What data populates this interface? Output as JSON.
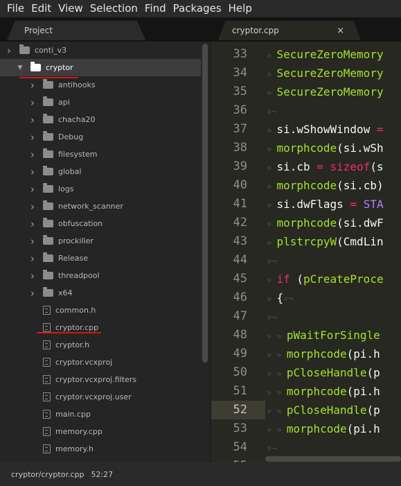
{
  "menubar": [
    "File",
    "Edit",
    "View",
    "Selection",
    "Find",
    "Packages",
    "Help"
  ],
  "tabs": {
    "project": "Project",
    "file": "cryptor.cpp",
    "close_glyph": "×"
  },
  "tree": [
    {
      "label": "conti_v3",
      "type": "folder",
      "expanded": false,
      "depth": 0
    },
    {
      "label": "cryptor",
      "type": "folder",
      "expanded": true,
      "depth": 1,
      "selected": true
    },
    {
      "label": "antihooks",
      "type": "folder",
      "depth": 2
    },
    {
      "label": "api",
      "type": "folder",
      "depth": 2
    },
    {
      "label": "chacha20",
      "type": "folder",
      "depth": 2
    },
    {
      "label": "Debug",
      "type": "folder",
      "depth": 2
    },
    {
      "label": "filesystem",
      "type": "folder",
      "depth": 2
    },
    {
      "label": "global",
      "type": "folder",
      "depth": 2
    },
    {
      "label": "logs",
      "type": "folder",
      "depth": 2
    },
    {
      "label": "network_scanner",
      "type": "folder",
      "depth": 2
    },
    {
      "label": "obfuscation",
      "type": "folder",
      "depth": 2
    },
    {
      "label": "prockiller",
      "type": "folder",
      "depth": 2
    },
    {
      "label": "Release",
      "type": "folder",
      "depth": 2
    },
    {
      "label": "threadpool",
      "type": "folder",
      "depth": 2
    },
    {
      "label": "x64",
      "type": "folder",
      "depth": 2
    },
    {
      "label": "common.h",
      "type": "file",
      "depth": 2
    },
    {
      "label": "cryptor.cpp",
      "type": "file",
      "depth": 2
    },
    {
      "label": "cryptor.h",
      "type": "file",
      "depth": 2
    },
    {
      "label": "cryptor.vcxproj",
      "type": "file",
      "depth": 2
    },
    {
      "label": "cryptor.vcxproj.filters",
      "type": "file",
      "depth": 2
    },
    {
      "label": "cryptor.vcxproj.user",
      "type": "file",
      "depth": 2
    },
    {
      "label": "main.cpp",
      "type": "file",
      "depth": 2
    },
    {
      "label": "memory.cpp",
      "type": "file",
      "depth": 2
    },
    {
      "label": "memory.h",
      "type": "file",
      "depth": 2
    }
  ],
  "editor": {
    "active_line": "52",
    "lines": [
      {
        "n": "33",
        "tokens": [
          [
            "inv",
            "» "
          ],
          [
            "fn",
            "SecureZeroMemory"
          ]
        ]
      },
      {
        "n": "34",
        "tokens": [
          [
            "inv",
            "» "
          ],
          [
            "fn",
            "SecureZeroMemory"
          ]
        ]
      },
      {
        "n": "35",
        "tokens": [
          [
            "inv",
            "» "
          ],
          [
            "fn",
            "SecureZeroMemory"
          ]
        ]
      },
      {
        "n": "36",
        "tokens": [
          [
            "inv",
            "¤¬"
          ]
        ]
      },
      {
        "n": "37",
        "tokens": [
          [
            "inv",
            "» "
          ],
          [
            "var",
            "si"
          ],
          [
            "punc",
            "."
          ],
          [
            "var",
            "wShowWindow"
          ],
          [
            "op",
            " ="
          ]
        ]
      },
      {
        "n": "38",
        "tokens": [
          [
            "inv",
            "» "
          ],
          [
            "fn",
            "morphcode"
          ],
          [
            "punc",
            "(si."
          ],
          [
            "var",
            "wSh"
          ]
        ]
      },
      {
        "n": "39",
        "tokens": [
          [
            "inv",
            "» "
          ],
          [
            "var",
            "si"
          ],
          [
            "punc",
            "."
          ],
          [
            "var",
            "cb"
          ],
          [
            "op",
            " = "
          ],
          [
            "kw",
            "sizeof"
          ],
          [
            "punc",
            "(s"
          ]
        ]
      },
      {
        "n": "40",
        "tokens": [
          [
            "inv",
            "» "
          ],
          [
            "fn",
            "morphcode"
          ],
          [
            "punc",
            "(si.cb)"
          ]
        ]
      },
      {
        "n": "41",
        "tokens": [
          [
            "inv",
            "» "
          ],
          [
            "var",
            "si"
          ],
          [
            "punc",
            "."
          ],
          [
            "var",
            "dwFlags"
          ],
          [
            "op",
            " = "
          ],
          [
            "const",
            "STA"
          ]
        ]
      },
      {
        "n": "42",
        "tokens": [
          [
            "inv",
            "» "
          ],
          [
            "fn",
            "morphcode"
          ],
          [
            "punc",
            "(si."
          ],
          [
            "var",
            "dwF"
          ]
        ]
      },
      {
        "n": "43",
        "tokens": [
          [
            "inv",
            "» "
          ],
          [
            "fn",
            "plstrcpyW"
          ],
          [
            "punc",
            "(CmdLin"
          ]
        ]
      },
      {
        "n": "44",
        "tokens": [
          [
            "inv",
            "¤¬"
          ]
        ]
      },
      {
        "n": "45",
        "tokens": [
          [
            "inv",
            "» "
          ],
          [
            "kw",
            "if"
          ],
          [
            "punc",
            " ("
          ],
          [
            "fn",
            "pCreateProce"
          ]
        ]
      },
      {
        "n": "46",
        "tokens": [
          [
            "inv",
            "» "
          ],
          [
            "punc",
            "{"
          ],
          [
            "inv",
            "¤¬"
          ]
        ]
      },
      {
        "n": "47",
        "tokens": [
          [
            "inv",
            "¤¬"
          ]
        ]
      },
      {
        "n": "48",
        "tokens": [
          [
            "inv",
            "» » "
          ],
          [
            "fn",
            "pWaitForSingle"
          ]
        ]
      },
      {
        "n": "49",
        "tokens": [
          [
            "inv",
            "» » "
          ],
          [
            "fn",
            "morphcode"
          ],
          [
            "punc",
            "(pi.h"
          ]
        ]
      },
      {
        "n": "50",
        "tokens": [
          [
            "inv",
            "» » "
          ],
          [
            "fn",
            "pCloseHandle"
          ],
          [
            "punc",
            "(p"
          ]
        ]
      },
      {
        "n": "51",
        "tokens": [
          [
            "inv",
            "» » "
          ],
          [
            "fn",
            "morphcode"
          ],
          [
            "punc",
            "(pi.h"
          ]
        ]
      },
      {
        "n": "52",
        "tokens": [
          [
            "inv",
            "» » "
          ],
          [
            "fn",
            "pCloseHandle"
          ],
          [
            "punc",
            "(p"
          ]
        ]
      },
      {
        "n": "53",
        "tokens": [
          [
            "inv",
            "» » "
          ],
          [
            "fn",
            "morphcode"
          ],
          [
            "punc",
            "(pi.h"
          ]
        ]
      },
      {
        "n": "54",
        "tokens": [
          [
            "inv",
            "¤¬"
          ]
        ]
      },
      {
        "n": "55",
        "tokens": []
      }
    ]
  },
  "statusbar": {
    "path": "cryptor/cryptor.cpp",
    "cursor": "52:27"
  },
  "colors": {
    "function": "#a6e22e",
    "keyword": "#f92672",
    "constant": "#ae81ff",
    "annotation_underline": "#d11717"
  },
  "icons": {
    "folder": "folder-icon",
    "file": "file-icon",
    "expand": "chevron-right-icon",
    "collapse": "chevron-down-icon"
  }
}
